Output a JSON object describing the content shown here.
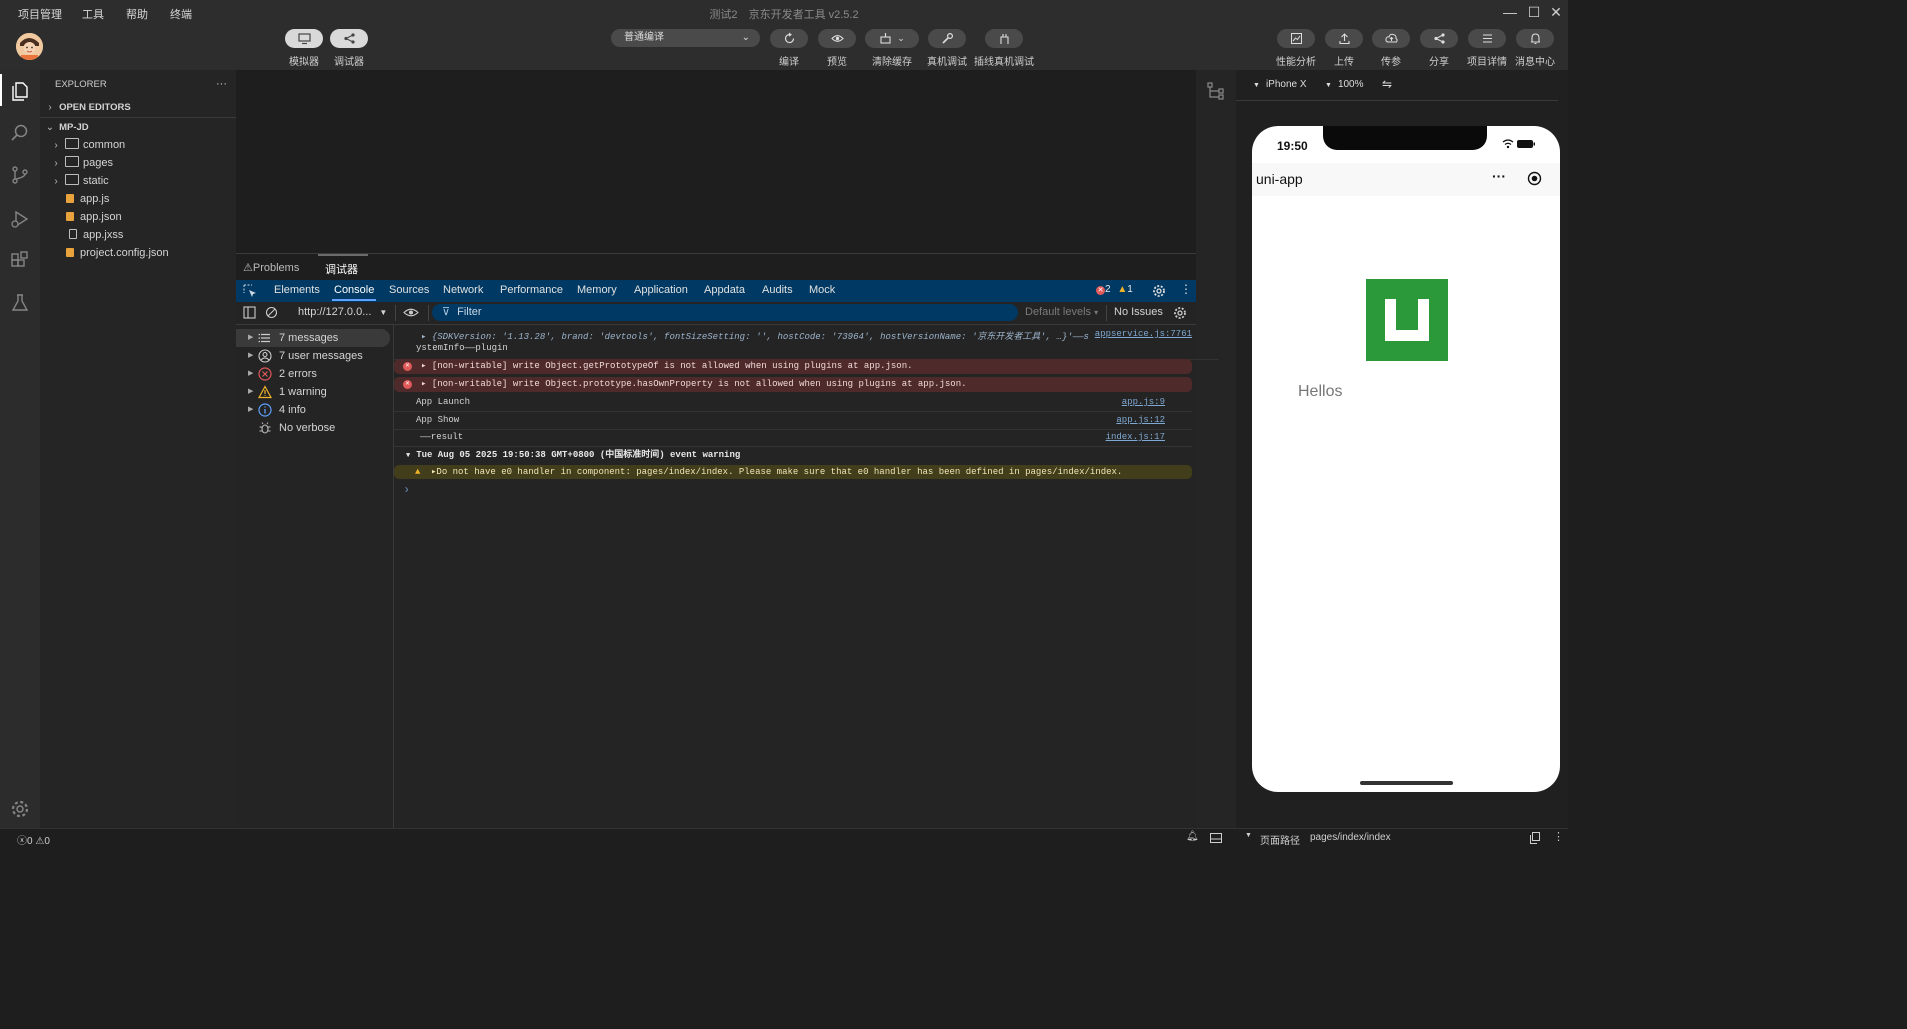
{
  "menu": [
    "项目管理",
    "工具",
    "帮助",
    "终端"
  ],
  "window": {
    "title": "测试2",
    "subtitle": "京东开发者工具 v2.5.2"
  },
  "toolbar": {
    "simulator": "模拟器",
    "debugger": "调试器",
    "compile_mode": "普通编译",
    "compile": "编译",
    "preview": "预览",
    "clear_cache": "清除缓存",
    "real_debug": "真机调试",
    "wired_debug": "插线真机调试",
    "perf": "性能分析",
    "upload": "上传",
    "push": "传参",
    "share": "分享",
    "details": "项目详情",
    "messages": "消息中心"
  },
  "explorer": {
    "title": "EXPLORER",
    "more": "···",
    "open_editors": "OPEN EDITORS",
    "project": "MP-JD",
    "folders": [
      "common",
      "pages",
      "static"
    ],
    "files": [
      "app.js",
      "app.json",
      "app.jxss",
      "project.config.json"
    ]
  },
  "panel": {
    "problems": "Problems",
    "debugger": "调试器"
  },
  "devtools": {
    "tabs": [
      "Elements",
      "Console",
      "Sources",
      "Network",
      "Performance",
      "Memory",
      "Application",
      "Appdata",
      "Audits",
      "Mock"
    ],
    "errors": "2",
    "warnings": "1",
    "context": "http://127.0.0...",
    "filter": "Filter",
    "levels": "Default levels",
    "issues": "No Issues"
  },
  "console_sidebar": [
    "7 messages",
    "7 user messages",
    "2 errors",
    "1 warning",
    "4 info",
    "No verbose"
  ],
  "console": {
    "sdk_line": "▸ {SDKVersion: '1.13.28', brand: 'devtools', fontSizeSetting: '', hostCode: '73964', hostVersionName: '京东开发者工具', …}'——s",
    "sdk_src": "appservice.js:7761",
    "sdk_cont": "ystemInfo——plugin",
    "err1": "▸ [non-writable] write Object.getPrototypeOf is not allowed when using plugins at app.json.",
    "err2": "▸ [non-writable] write Object.prototype.hasOwnProperty is not allowed when using plugins at app.json.",
    "launch": "App Launch",
    "launch_src": "app.js:9",
    "show": "App Show",
    "show_src": "app.js:12",
    "result": "——result",
    "result_src": "index.js:17",
    "group": "Tue Aug 05 2025 19:50:38 GMT+0800 (中国标准时间) event warning",
    "warn": "▸Do not have e0 handler in component: pages/index/index. Please make sure that e0 handler has been defined in pages/index/index.",
    "prompt": "›"
  },
  "simulator": {
    "device": "iPhone X",
    "zoom": "100%",
    "time": "19:50",
    "nav_title": "uni-app",
    "more": "···",
    "hello": "Hellos"
  },
  "status": {
    "errors": "0",
    "warnings": "0",
    "path_label": "页面路径",
    "path": "pages/index/index"
  },
  "colors": {
    "logo_green": "#2b9939",
    "devtab_blue": "#003a64"
  }
}
